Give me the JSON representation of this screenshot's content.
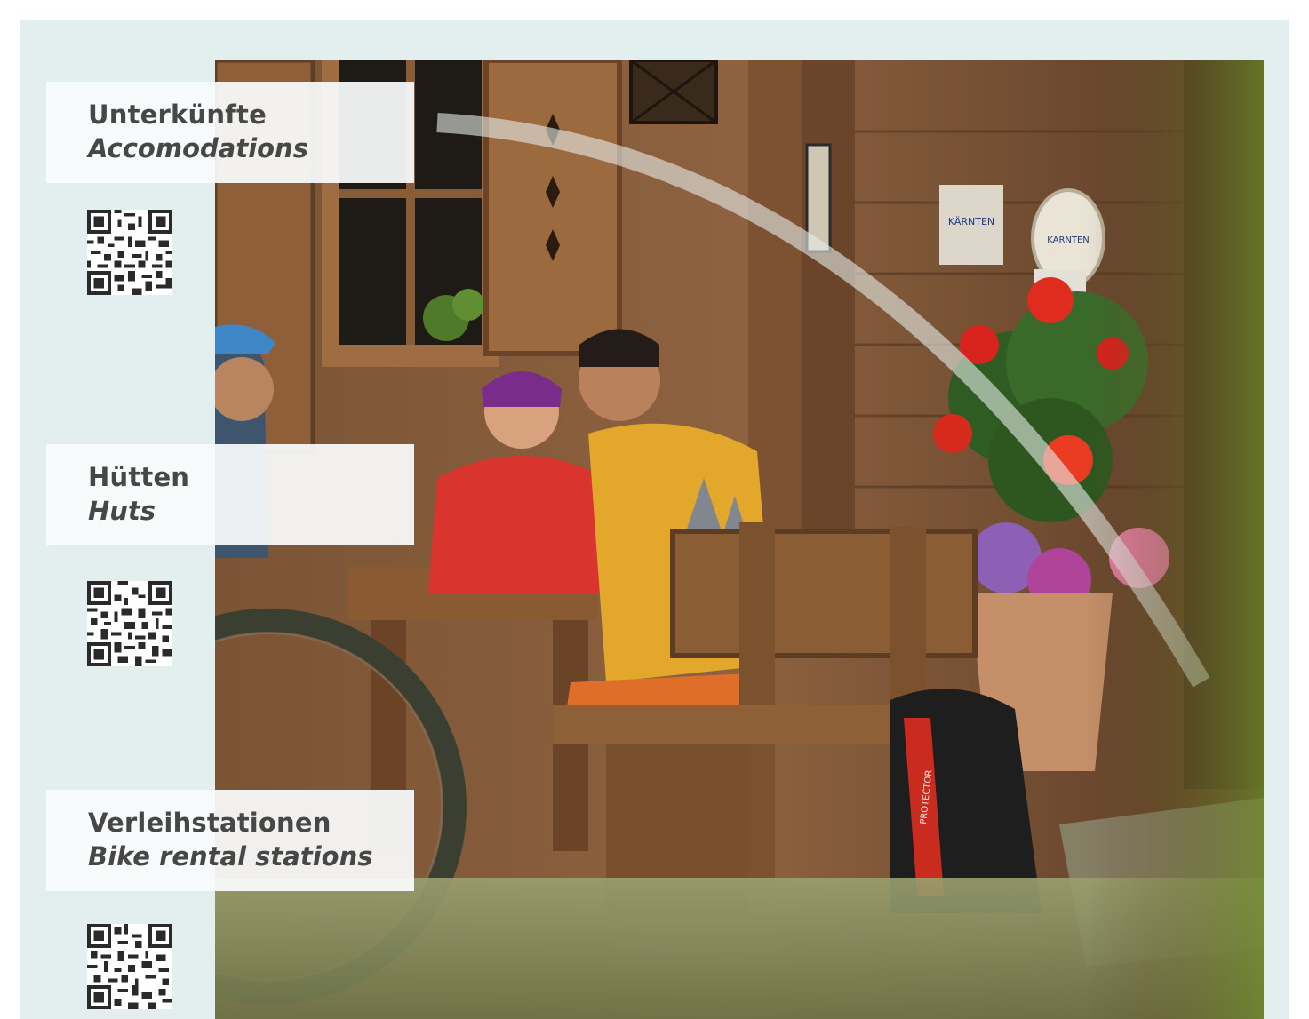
{
  "sections": [
    {
      "title_de": "Unterkünfte",
      "title_en": "Accomodations",
      "qr_icon": "qr-code-icon"
    },
    {
      "title_de": "Hütten",
      "title_en": "Huts",
      "qr_icon": "qr-code-icon"
    },
    {
      "title_de": "Verleihstationen",
      "title_en": "Bike rental stations",
      "qr_icon": "qr-code-icon"
    }
  ],
  "photo": {
    "sign_text_1": "KÄRNTEN",
    "sign_text_2": "KÄRNTEN",
    "backpack_text": "PROTECTOR"
  },
  "colors": {
    "frame_background": "#e3eeee",
    "card_background": "#fafcfc",
    "label_text": "#474747",
    "wood_dark": "#5e3f26",
    "wood_light": "#9a6a42"
  }
}
